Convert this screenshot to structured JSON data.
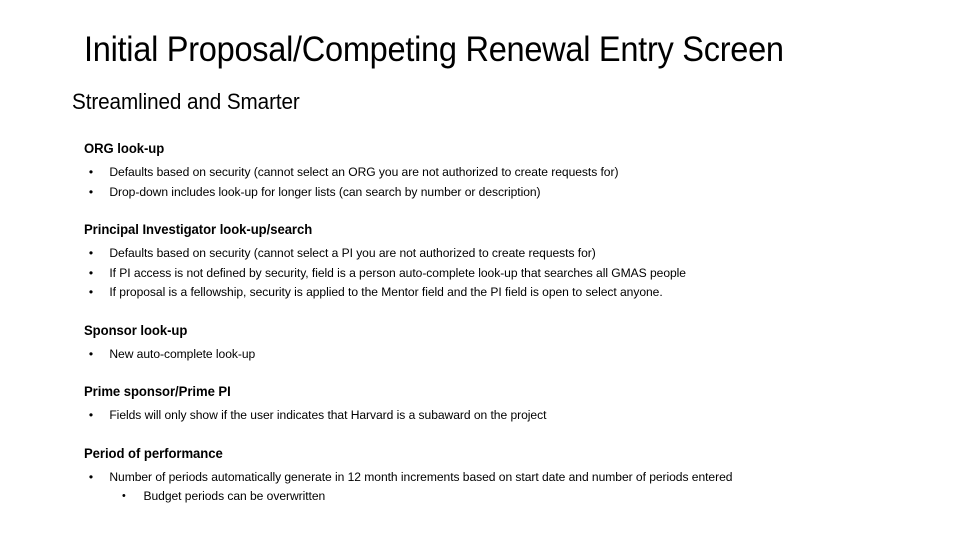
{
  "slide": {
    "title": "Initial Proposal/Competing Renewal Entry Screen",
    "subtitle": "Streamlined and Smarter",
    "bullet_glyph": "•",
    "sub_bullet_glyph": "•",
    "text_color": "#000000",
    "background_color": "#FFFFFF",
    "sections": [
      {
        "heading": "ORG look-up",
        "bullets": [
          {
            "text": "Defaults based on security (cannot select an ORG you are not authorized to create requests for)",
            "sub_bullets": []
          },
          {
            "text": "Drop-down includes look-up for longer lists (can search by number or description)",
            "sub_bullets": []
          }
        ]
      },
      {
        "heading": "Principal Investigator look-up/search",
        "bullets": [
          {
            "text": "Defaults based on security (cannot select a PI you are not authorized to create requests for)",
            "sub_bullets": []
          },
          {
            "text": "If PI access is not defined by security, field is a person auto-complete look-up that searches all GMAS people",
            "sub_bullets": []
          },
          {
            "text": "If proposal is a fellowship, security is applied to the Mentor field and the PI field is open to select anyone.",
            "sub_bullets": []
          }
        ]
      },
      {
        "heading": "Sponsor look-up",
        "bullets": [
          {
            "text": "New auto-complete look-up",
            "sub_bullets": []
          }
        ]
      },
      {
        "heading": "Prime sponsor/Prime PI",
        "bullets": [
          {
            "text": "Fields will only show if the user indicates that Harvard is a subaward on the project",
            "sub_bullets": []
          }
        ]
      },
      {
        "heading": "Period of performance",
        "bullets": [
          {
            "text": "Number of periods automatically generate in 12 month increments based on start date and number of periods entered",
            "sub_bullets": [
              "Budget periods can be overwritten"
            ]
          }
        ]
      }
    ]
  }
}
